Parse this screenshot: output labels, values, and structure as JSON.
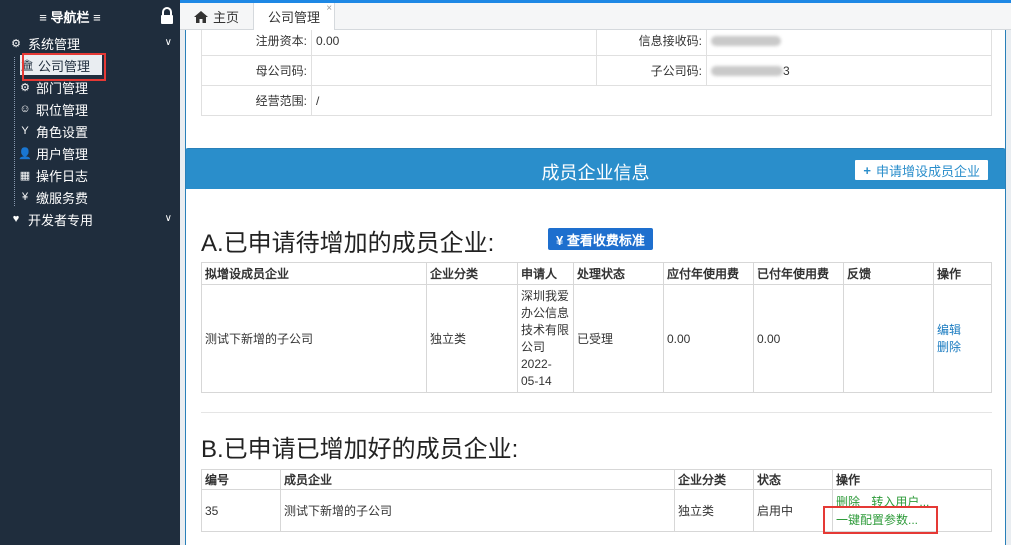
{
  "sidebar": {
    "title": "≡ 导航栏 ≡",
    "groups": [
      {
        "label": "系统管理",
        "icon": "gears-icon"
      },
      {
        "label": "开发者专用",
        "icon": "heart-icon"
      }
    ],
    "items": [
      {
        "label": "公司管理",
        "icon": "bank-icon"
      },
      {
        "label": "部门管理",
        "icon": "gears-icon"
      },
      {
        "label": "职位管理",
        "icon": "smile-icon"
      },
      {
        "label": "角色设置",
        "icon": "filter-icon"
      },
      {
        "label": "用户管理",
        "icon": "user-icon"
      },
      {
        "label": "操作日志",
        "icon": "windows-icon"
      },
      {
        "label": "缴服务费",
        "icon": "yen-icon"
      }
    ]
  },
  "tabs": [
    {
      "label": "主页",
      "icon": "home-icon"
    },
    {
      "label": "公司管理",
      "close": "×"
    }
  ],
  "company_info": {
    "registered_capital_label": "注册资本:",
    "registered_capital_value": "0.00",
    "info_receiver_label": "信息接收码:",
    "parent_code_label": "母公司码:",
    "sub_code_label": "子公司码:",
    "sub_code_suffix": "3",
    "scope_label": "经营范围:",
    "scope_value": "/"
  },
  "members": {
    "panel_title": "成员企业信息",
    "apply_button": "申请增设成员企业",
    "apply_icon": "+",
    "section_a_title": "A.已申请待增加的成员企业:",
    "fee_button": "¥ 查看收费标准",
    "table_a": {
      "headers": [
        "拟增设成员企业",
        "企业分类",
        "申请人",
        "处理状态",
        "应付年使用费",
        "已付年使用费",
        "反馈",
        "操作"
      ],
      "rows": [
        {
          "company": "测试下新增的子公司",
          "category": "独立类",
          "applicant": [
            "深圳我爱",
            "办公信息",
            "技术有限",
            "公司",
            "2022-",
            "05-14"
          ],
          "status": "已受理",
          "payable": "0.00",
          "paid": "0.00",
          "feedback": "",
          "actions": [
            "编辑",
            "删除"
          ]
        }
      ]
    },
    "section_b_title": "B.已申请已增加好的成员企业:",
    "table_b": {
      "headers": [
        "编号",
        "成员企业",
        "企业分类",
        "状态",
        "操作"
      ],
      "rows": [
        {
          "id": "35",
          "company": "测试下新增的子公司",
          "category": "独立类",
          "status": "启用中",
          "actions": [
            "删除",
            "转入用户...",
            "一键配置参数..."
          ]
        }
      ]
    }
  }
}
